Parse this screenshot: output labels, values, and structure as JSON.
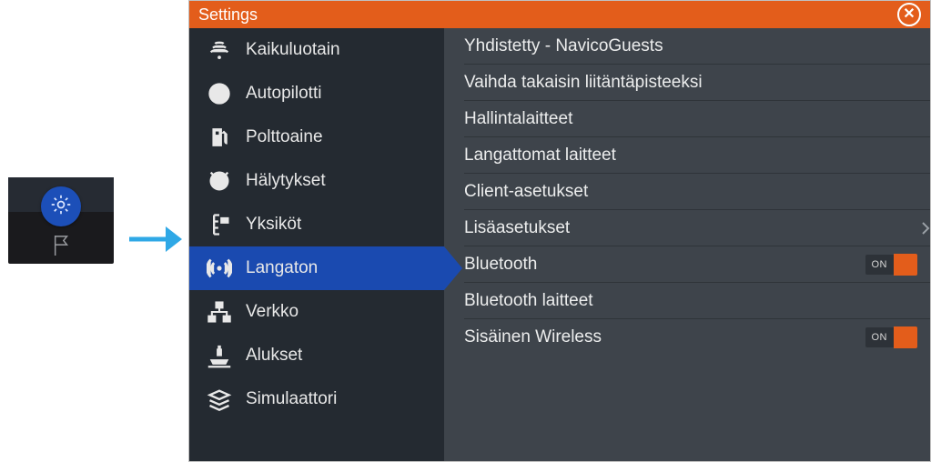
{
  "source_badge": {
    "icon": "gear-icon",
    "flag_icon": "flag-icon"
  },
  "arrow": {
    "icon": "arrow-right-icon",
    "color": "#2fa8e6"
  },
  "dialog": {
    "title": "Settings",
    "close_icon": "close-icon"
  },
  "sidebar": {
    "items": [
      {
        "icon": "sonar-icon",
        "label": "Kaikuluotain",
        "selected": false
      },
      {
        "icon": "autopilot-icon",
        "label": "Autopilotti",
        "selected": false
      },
      {
        "icon": "fuel-icon",
        "label": "Polttoaine",
        "selected": false
      },
      {
        "icon": "alarm-icon",
        "label": "Hälytykset",
        "selected": false
      },
      {
        "icon": "units-icon",
        "label": "Yksiköt",
        "selected": false
      },
      {
        "icon": "wireless-icon",
        "label": "Langaton",
        "selected": true
      },
      {
        "icon": "network-icon",
        "label": "Verkko",
        "selected": false
      },
      {
        "icon": "vessels-icon",
        "label": "Alukset",
        "selected": false
      },
      {
        "icon": "simulator-icon",
        "label": "Simulaattori",
        "selected": false
      }
    ]
  },
  "content": {
    "rows": [
      {
        "label": "Yhdistetty - NavicoGuests",
        "type": "nav"
      },
      {
        "label": "Vaihda takaisin liitäntäpisteeksi",
        "type": "nav"
      },
      {
        "label": "Hallintalaitteet",
        "type": "nav"
      },
      {
        "label": "Langattomat laitteet",
        "type": "nav"
      },
      {
        "label": "Client-asetukset",
        "type": "nav"
      },
      {
        "label": "Lisäasetukset",
        "type": "nav",
        "chevron": true
      },
      {
        "label": "Bluetooth",
        "type": "toggle",
        "state": "ON"
      },
      {
        "label": "Bluetooth laitteet",
        "type": "nav"
      },
      {
        "label": "Sisäinen Wireless",
        "type": "toggle",
        "state": "ON"
      }
    ]
  },
  "colors": {
    "accent": "#e35d1b",
    "selection": "#1a4ab0",
    "sidebar_bg": "#242a31",
    "content_bg": "#3e444b"
  }
}
